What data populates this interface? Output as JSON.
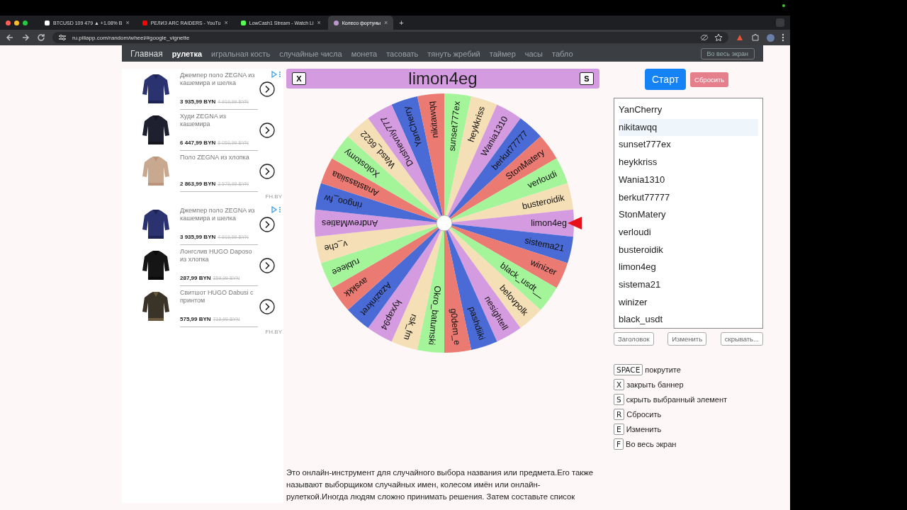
{
  "browser": {
    "tabs": [
      {
        "title": "BTCUSD 109 479 ▲ +1.08% В",
        "close": "×",
        "selected": false
      },
      {
        "title": "РЕЛИЗ ARC RAIDERS - YouTu",
        "close": "×",
        "selected": false
      },
      {
        "title": "LowCash1 Stream - Watch Li",
        "close": "×",
        "selected": false
      },
      {
        "title": "Колесо фортуны",
        "close": "×",
        "selected": true
      }
    ],
    "new_tab": "+",
    "address": "ru.piliapp.com/random/wheel/#google_vignette"
  },
  "nav": {
    "items": [
      {
        "label": "Главная",
        "selected": false
      },
      {
        "label": "рулетка",
        "selected": true
      },
      {
        "label": "игральная кость",
        "selected": false
      },
      {
        "label": "случайные числа",
        "selected": false
      },
      {
        "label": "монета",
        "selected": false
      },
      {
        "label": "тасовать",
        "selected": false
      },
      {
        "label": "тянуть жребий",
        "selected": false
      },
      {
        "label": "таймер",
        "selected": false
      },
      {
        "label": "часы",
        "selected": false
      },
      {
        "label": "табло",
        "selected": false
      }
    ],
    "fullscreen_button": "Во весь экран"
  },
  "ads": [
    {
      "items": [
        {
          "title": "Джемпер поло ZEGNA из кашемира и шелка",
          "price": "3 935,99 BYN",
          "old_price": "4 919,99 BYN"
        },
        {
          "title": "Худи ZEGNA из кашемира",
          "price": "6 447,99 BYN",
          "old_price": "8 059,99 BYN"
        },
        {
          "title": "Поло ZEGNA из хлопка",
          "price": "2 863,99 BYN",
          "old_price": "3 579,99 BYN"
        }
      ],
      "source": "FH.BY"
    },
    {
      "items": [
        {
          "title": "Джемпер поло ZEGNA из кашемира и шелка",
          "price": "3 935,99 BYN",
          "old_price": "4 919,99 BYN"
        },
        {
          "title": "Лонгслив HUGO Daposo из хлопка",
          "price": "287,99 BYN",
          "old_price": "359,99 BYN"
        },
        {
          "title": "Свитшот HUGO Dabusi с принтом",
          "price": "575,99 BYN",
          "old_price": "719,99 BYN"
        }
      ],
      "source": "FH.BY"
    }
  ],
  "wheel": {
    "close_key": "X",
    "title": "limon4eg",
    "hide_key": "S",
    "segments": [
      "YanCherry",
      "nikitawqq",
      "sunset777ex",
      "heykkriss",
      "Wania1310",
      "berkut77777",
      "StonMatery",
      "verloudi",
      "busteroidik",
      "limon4eg",
      "sistema21",
      "winizer",
      "black_usdt__",
      "belovpolk",
      "nesightell",
      "pashdiiki",
      "g0dem_e",
      "Okro_batumski",
      "rsk_fm",
      "kyxap94",
      "Azazinkret",
      "avskkk",
      "rubleee",
      "v_che",
      "AndrewMaties",
      "ringoo_fw",
      "Anastassiiaa",
      "Xolostomy",
      "Wasd_6622",
      "Dushevniy777"
    ]
  },
  "controls": {
    "start": "Старт",
    "reset": "Сбросить"
  },
  "entries": [
    {
      "text": "YanCherry",
      "highlighted": false
    },
    {
      "text": "nikitawqq",
      "highlighted": true
    },
    {
      "text": "sunset777ex",
      "highlighted": false
    },
    {
      "text": "heykkriss",
      "highlighted": false
    },
    {
      "text": "Wania1310",
      "highlighted": false
    },
    {
      "text": "berkut77777",
      "highlighted": false
    },
    {
      "text": "StonMatery",
      "highlighted": false
    },
    {
      "text": "verloudi",
      "highlighted": false
    },
    {
      "text": "busteroidik",
      "highlighted": false
    },
    {
      "text": "limon4eg",
      "highlighted": false
    },
    {
      "text": "sistema21",
      "highlighted": false
    },
    {
      "text": "winizer",
      "highlighted": false
    },
    {
      "text": "black_usdt",
      "highlighted": false
    }
  ],
  "actions": [
    "Заголовок",
    "Изменить",
    "скрывать..."
  ],
  "shortcuts": [
    {
      "key": "SPACE",
      "action": "покрутите"
    },
    {
      "key": "X",
      "action": "закрыть баннер"
    },
    {
      "key": "S",
      "action": "скрыть выбранный элемент"
    },
    {
      "key": "R",
      "action": "Сбросить"
    },
    {
      "key": "E",
      "action": "Изменить"
    },
    {
      "key": "F",
      "action": "Во весь экран"
    }
  ],
  "description": "Это онлайн-инструмент для случайного выбора названия или предмета.Его также называют выборщиком случайных имен, колесом имён или онлайн-рулеткой.Иногда людям сложно принимать решения. Затем составьте список"
}
